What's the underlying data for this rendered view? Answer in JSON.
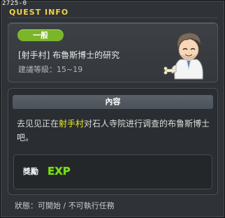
{
  "window": {
    "id": "2725-0",
    "title": "QUEST INFO"
  },
  "quest": {
    "category": "一般",
    "name": "[射手村] 布魯斯博士的研究",
    "level_requirement": "建議等級：15~19"
  },
  "content": {
    "header": "內容",
    "description_before": "去见见正在",
    "description_highlight": "射手村",
    "description_after": "对石人寺院进行调查的布鲁斯博士吧。"
  },
  "reward": {
    "label": "獎勵",
    "icon": "exp-icon",
    "icon_text": "EXP"
  },
  "status": "狀態：可開始 / 不可執行任務",
  "colors": {
    "title": "#f2d24a",
    "badge": "#7ab52a",
    "highlight": "#ecf01c",
    "exp": "#7dde1f"
  }
}
